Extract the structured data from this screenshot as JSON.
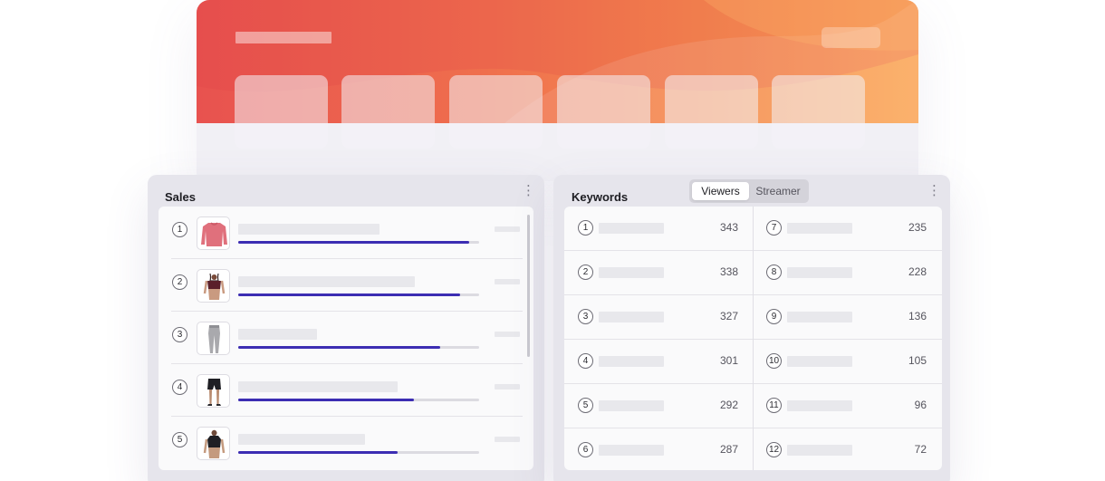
{
  "sales": {
    "title": "Sales",
    "menu_icon": "vertical-dots-icon",
    "items": [
      {
        "rank": "1",
        "product": "pink-sweatshirt",
        "share": 0.96
      },
      {
        "rank": "2",
        "product": "sports-bra",
        "share": 0.92
      },
      {
        "rank": "3",
        "product": "grey-leggings",
        "share": 0.84
      },
      {
        "rank": "4",
        "product": "black-shorts",
        "share": 0.73
      },
      {
        "rank": "5",
        "product": "black-crop-top",
        "share": 0.66
      }
    ],
    "accent_color": "#3c2db3"
  },
  "keywords": {
    "title": "Keywords",
    "menu_icon": "vertical-dots-icon",
    "tabs": [
      {
        "label": "Viewers",
        "active": true
      },
      {
        "label": "Streamer",
        "active": false
      }
    ],
    "left_column": [
      {
        "rank": "1",
        "count": "343"
      },
      {
        "rank": "2",
        "count": "338"
      },
      {
        "rank": "3",
        "count": "327"
      },
      {
        "rank": "4",
        "count": "301"
      },
      {
        "rank": "5",
        "count": "292"
      },
      {
        "rank": "6",
        "count": "287"
      }
    ],
    "right_column": [
      {
        "rank": "7",
        "count": "235"
      },
      {
        "rank": "8",
        "count": "228"
      },
      {
        "rank": "9",
        "count": "136"
      },
      {
        "rank": "10",
        "count": "105"
      },
      {
        "rank": "11",
        "count": "96"
      },
      {
        "rank": "12",
        "count": "72"
      }
    ]
  },
  "hero": {
    "gradient": [
      "#e8524f",
      "#fba95c"
    ]
  }
}
